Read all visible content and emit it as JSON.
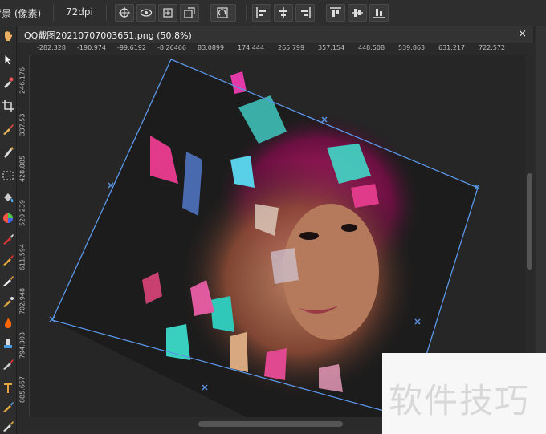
{
  "toolbar": {
    "doc_info": "背景 (像素)",
    "dpi": "72dpi",
    "buttons": [
      "crosshair-icon",
      "eye-icon",
      "bbox-icon",
      "transform-icon",
      "rotate-icon",
      "align-left-icon",
      "align-center-icon",
      "align-right-icon",
      "align-top-icon",
      "align-middle-icon",
      "align-bottom-icon"
    ]
  },
  "document": {
    "tab_title": "QQ截图20210707003651.png (50.8%)",
    "close_glyph": "×",
    "zoom": "50.8%"
  },
  "ruler": {
    "unit": "px",
    "top_ticks": [
      "-282.328",
      "-190.974",
      "-99.6192",
      "-8.26466",
      "83.0899",
      "174.444",
      "265.799",
      "357.154",
      "448.508",
      "539.863",
      "631.217",
      "722.572"
    ],
    "left_ticks": [
      "246.176",
      "337.53",
      "428.885",
      "520.239",
      "611.594",
      "702.948",
      "794.303",
      "885.657"
    ]
  },
  "tools": [
    "hand-icon",
    "move-icon",
    "eyedropper-icon",
    "crop-icon",
    "brush-icon",
    "pen-icon",
    "marquee-icon",
    "fill-icon",
    "color-icon",
    "paint-icon",
    "brush2-icon",
    "pencil-icon",
    "smudge-icon",
    "burn-icon",
    "stamp-icon",
    "clone-icon",
    "text-icon",
    "shape-icon"
  ],
  "watermark": "软件技巧",
  "colors": {
    "accent": "#4a8fe0",
    "selection": "#5b95e6"
  }
}
